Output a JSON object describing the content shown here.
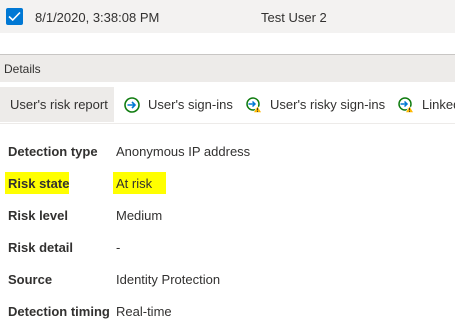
{
  "selected_row": {
    "checked": true,
    "date": "8/1/2020, 3:38:08 PM",
    "user": "Test User 2"
  },
  "details_header": "Details",
  "tabs": [
    {
      "label": "User's risk report",
      "icon": "none"
    },
    {
      "label": "User's sign-ins",
      "icon": "sign-in-arrow-icon"
    },
    {
      "label": "User's risky sign-ins",
      "icon": "risky-sign-in-icon"
    },
    {
      "label": "Linked",
      "icon": "risky-sign-in-icon"
    }
  ],
  "properties": [
    {
      "label": "Detection type",
      "value": "Anonymous IP address",
      "highlighted": false
    },
    {
      "label": "Risk state",
      "value": "At risk",
      "highlighted": true
    },
    {
      "label": "Risk level",
      "value": "Medium",
      "highlighted": false
    },
    {
      "label": "Risk detail",
      "value": "-",
      "highlighted": false
    },
    {
      "label": "Source",
      "value": "Identity Protection",
      "highlighted": false
    },
    {
      "label": "Detection timing",
      "value": "Real-time",
      "highlighted": false
    }
  ],
  "colors": {
    "accent": "#0078d4",
    "icon_green": "#107c10",
    "icon_blue": "#0078d4",
    "warning_yellow": "#ffb900",
    "highlight": "#ffff00"
  }
}
